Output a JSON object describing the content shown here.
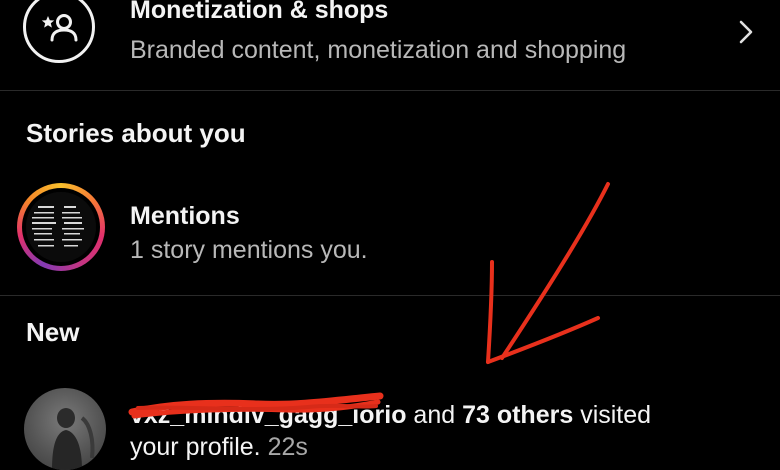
{
  "monetization": {
    "title": "Monetization & shops",
    "subtitle": "Branded content, monetization and shopping",
    "icon": "person-star-icon",
    "chevron_icon": "chevron-right-icon"
  },
  "stories_section": {
    "header": "Stories about you",
    "mentions": {
      "title": "Mentions",
      "subtitle": "1 story mentions you."
    }
  },
  "new_section": {
    "header": "New",
    "notification": {
      "username": "vxz_mindlv_gagg_iorio",
      "connector": " and ",
      "others": "73 others",
      "suffix": " visited",
      "line2": "your profile.",
      "time": "22s"
    }
  },
  "colors": {
    "background": "#000000",
    "primary_text": "#f4f4f4",
    "secondary_text": "#b8b8b8",
    "divider": "#2a2a2a",
    "annotation_red": "#e8301c"
  }
}
